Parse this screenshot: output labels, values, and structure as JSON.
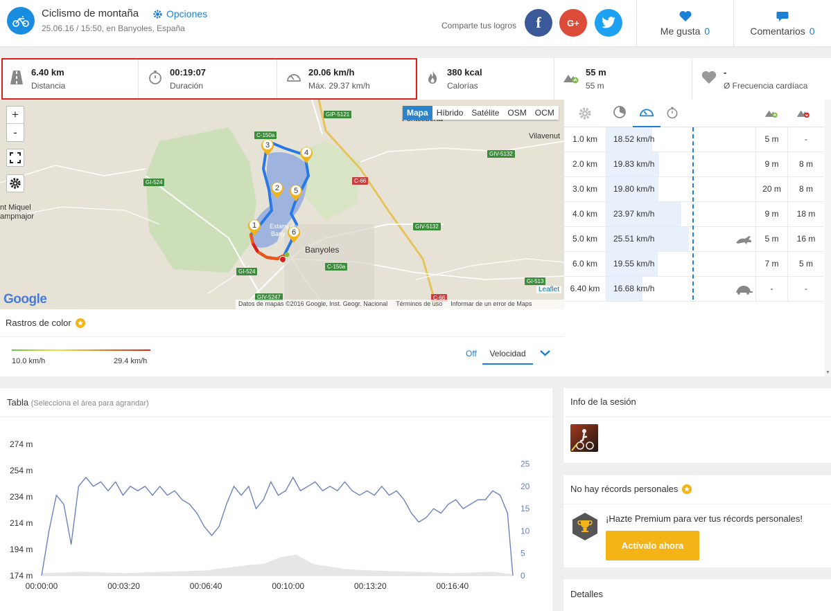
{
  "header": {
    "title": "Ciclismo de montaña",
    "options_label": "Opciones",
    "subtitle": "25.06.16 / 15:50, en Banyoles, España",
    "share_text": "Comparte tus logros",
    "likes_label": "Me gusta",
    "likes_count": "0",
    "comments_label": "Comentarios",
    "comments_count": "0",
    "social": [
      {
        "name": "facebook",
        "glyph": "f",
        "color": "#3b5998"
      },
      {
        "name": "google-plus",
        "glyph": "G+",
        "color": "#dd4b39"
      },
      {
        "name": "twitter",
        "glyph": "t",
        "color": "#1da1f2"
      }
    ]
  },
  "stats": [
    {
      "icon": "road-icon",
      "value": "6.40 km",
      "label": "Distancia"
    },
    {
      "icon": "stopwatch-icon",
      "value": "00:19:07",
      "label": "Duración"
    },
    {
      "icon": "speedometer-icon",
      "value": "20.06 km/h",
      "label": "Máx. 29.37 km/h"
    },
    {
      "icon": "flame-icon",
      "value": "380 kcal",
      "label": "Calorías"
    },
    {
      "icon": "elevation-up-icon",
      "value": "55 m",
      "label": "55 m"
    },
    {
      "icon": "heart-icon",
      "value": "-",
      "label": "Ø Frecuencia cardíaca"
    }
  ],
  "map": {
    "zoom_in": "+",
    "zoom_out": "-",
    "tabs": [
      "Mapa",
      "Híbrido",
      "Satélite",
      "OSM",
      "OCM"
    ],
    "active_tab": "Mapa",
    "places": [
      "Fontcoberta",
      "Vilavenut",
      "nt Miquel",
      "ampmajor",
      "Banyoles",
      "Estany de",
      "Bany"
    ],
    "roads": [
      "GIP-5121",
      "C-150a",
      "GIV-5132",
      "GI-524",
      "C-66",
      "GIV-5132",
      "C-150a",
      "GI-524",
      "GIV-5247",
      "GI-513",
      "C-66"
    ],
    "markers": [
      "1",
      "2",
      "3",
      "4",
      "5",
      "6"
    ],
    "google": "Google",
    "leaflet": "Leaflet",
    "attribution": "Datos de mapas ©2016 Google, Inst. Geogr. Nacional",
    "terms": "Términos de uso",
    "report": "Informar de un error de Maps"
  },
  "color_tracks": {
    "title": "Rastros de color",
    "min": "10.0 km/h",
    "max": "29.4 km/h",
    "off": "Off",
    "selected": "Velocidad"
  },
  "splits": {
    "rows": [
      {
        "km": "1.0 km",
        "speed": "18.52 km/h",
        "frac": 0.306,
        "up": "5 m",
        "down": "-",
        "badge": ""
      },
      {
        "km": "2.0 km",
        "speed": "19.83 km/h",
        "frac": 0.352,
        "up": "9 m",
        "down": "8 m",
        "badge": ""
      },
      {
        "km": "3.0 km",
        "speed": "19.80 km/h",
        "frac": 0.351,
        "up": "20 m",
        "down": "8 m",
        "badge": ""
      },
      {
        "km": "4.0 km",
        "speed": "23.97 km/h",
        "frac": 0.5,
        "up": "9 m",
        "down": "18 m",
        "badge": ""
      },
      {
        "km": "5.0 km",
        "speed": "25.51 km/h",
        "frac": 0.554,
        "up": "5 m",
        "down": "16 m",
        "badge": "rabbit-icon"
      },
      {
        "km": "6.0 km",
        "speed": "19.55 km/h",
        "frac": 0.342,
        "up": "7 m",
        "down": "5 m",
        "badge": ""
      },
      {
        "km": "6.40 km",
        "speed": "16.68 km/h",
        "frac": 0.241,
        "up": "-",
        "down": "-",
        "badge": "turtle-icon"
      }
    ]
  },
  "chart": {
    "title": "Tabla",
    "hint": "(Selecciona el área para agrandar)"
  },
  "chart_data": {
    "type": "line",
    "ylabels_left": [
      "274 m",
      "254 m",
      "234 m",
      "214 m",
      "194 m",
      "174 m"
    ],
    "ylabels_right": [
      "25",
      "20",
      "15",
      "10",
      "5",
      "0"
    ],
    "xlabels": [
      "00:00:00",
      "00:03:20",
      "00:06:40",
      "00:10:00",
      "00:13:20",
      "00:16:40"
    ],
    "ylim_left": [
      174,
      274
    ],
    "ylim_right": [
      0,
      25
    ],
    "xlim": [
      0,
      1147
    ],
    "series": [
      {
        "color": "#6b82bd",
        "axis": "right",
        "x": [
          0,
          18,
          36,
          54,
          72,
          90,
          108,
          126,
          144,
          162,
          180,
          198,
          216,
          234,
          252,
          270,
          288,
          306,
          324,
          342,
          360,
          378,
          396,
          414,
          432,
          450,
          468,
          486,
          504,
          522,
          540,
          558,
          576,
          594,
          612,
          630,
          648,
          666,
          684,
          702,
          720,
          738,
          756,
          774,
          792,
          810,
          828,
          846,
          864,
          882,
          900,
          918,
          936,
          954,
          972,
          990,
          1008,
          1026,
          1044,
          1062,
          1080,
          1098,
          1116,
          1134,
          1147
        ],
        "y": [
          0,
          10,
          18,
          16,
          7,
          20,
          22,
          20,
          21,
          19,
          21,
          18,
          20,
          19,
          20,
          18,
          20,
          18,
          19,
          17,
          16,
          14,
          11,
          9,
          11,
          16,
          20,
          18,
          20,
          15,
          17,
          21,
          18,
          19,
          22,
          19,
          20,
          21,
          19,
          20,
          19,
          21,
          19,
          18,
          19,
          18,
          20,
          18,
          19,
          17,
          14,
          12,
          13,
          15,
          14,
          16,
          17,
          15,
          16,
          17,
          17,
          19,
          18,
          14,
          0
        ]
      },
      {
        "color": "#e6e6e6",
        "axis": "left",
        "fill": true,
        "x": [
          0,
          100,
          200,
          300,
          400,
          450,
          500,
          540,
          580,
          620,
          660,
          700,
          740,
          800,
          900,
          1000,
          1100,
          1147
        ],
        "y": [
          176,
          177,
          176,
          177,
          178,
          180,
          182,
          183,
          188,
          190,
          183,
          181,
          179,
          178,
          177,
          176,
          177,
          175
        ]
      }
    ]
  },
  "session": {
    "title": "Info de la sesión"
  },
  "records": {
    "title": "No hay récords personales",
    "premium_text": "¡Hazte Premium para ver tus récords personales!",
    "button": "Actívalo ahora"
  },
  "details": {
    "title": "Detalles"
  },
  "colors": {
    "accent": "#1b7fd6",
    "premium": "#f4b316",
    "highlight": "#d9201f",
    "route": "#2a78e4"
  }
}
